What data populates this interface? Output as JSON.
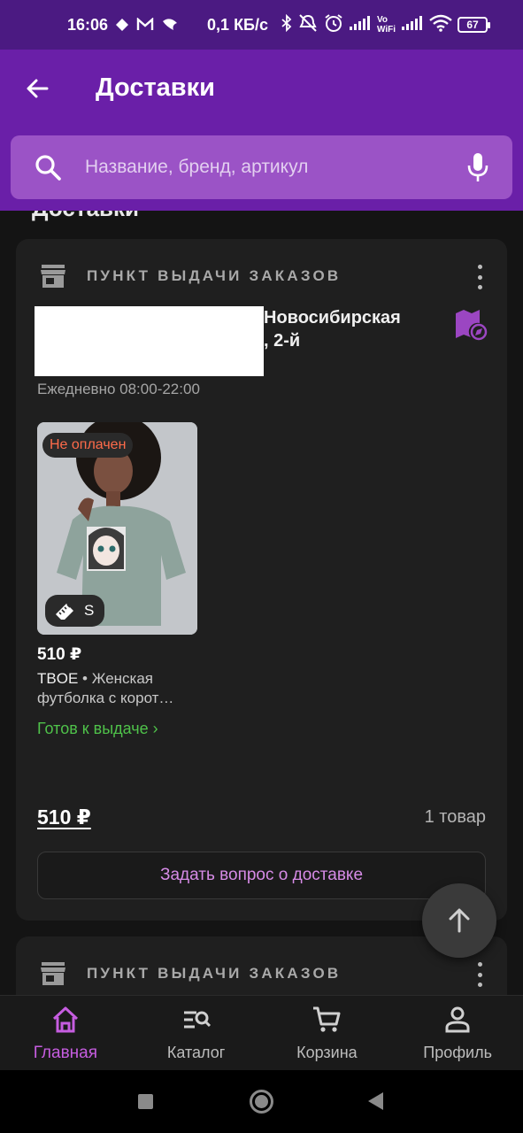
{
  "status_bar": {
    "time": "16:06",
    "network_speed": "0,1 КБ/с",
    "volte_label_top": "Vo",
    "volte_label_bottom": "WiFi",
    "battery_level": "67"
  },
  "app_bar": {
    "title": "Доставки",
    "search_placeholder": "Название, бренд, артикул"
  },
  "content": {
    "section_peek": "Доставки",
    "delivery": {
      "header_label": "ПУНКТ ВЫДАЧИ ЗАКАЗОВ",
      "address_line1": "Новосибирская",
      "address_line2": ", 2-й",
      "hours": "Ежедневно 08:00-22:00",
      "product": {
        "status_badge": "Не оплачен",
        "size": "S",
        "price": "510 ₽",
        "brand": "TBOE",
        "separator": " • ",
        "name_line1": "Женская",
        "name_line2": "футболка с корот…",
        "ready_label": "Готов к выдаче ›"
      },
      "total": "510 ₽",
      "count": "1 товар",
      "ask_button": "Задать вопрос о доставке"
    },
    "delivery2": {
      "header_label": "ПУНКТ ВЫДАЧИ ЗАКАЗОВ"
    }
  },
  "bottom_nav": [
    {
      "label": "Главная",
      "icon": "home-icon",
      "active": true
    },
    {
      "label": "Каталог",
      "icon": "catalog-search-icon",
      "active": false
    },
    {
      "label": "Корзина",
      "icon": "cart-icon",
      "active": false
    },
    {
      "label": "Профиль",
      "icon": "profile-icon",
      "active": false
    }
  ],
  "colors": {
    "app_bar": "#6a1fa8",
    "status_bar": "#4b1a82",
    "search_bg": "#9b53c6",
    "accent": "#c65de0",
    "unpaid": "#ff6b4a",
    "ready": "#4fc24a"
  }
}
